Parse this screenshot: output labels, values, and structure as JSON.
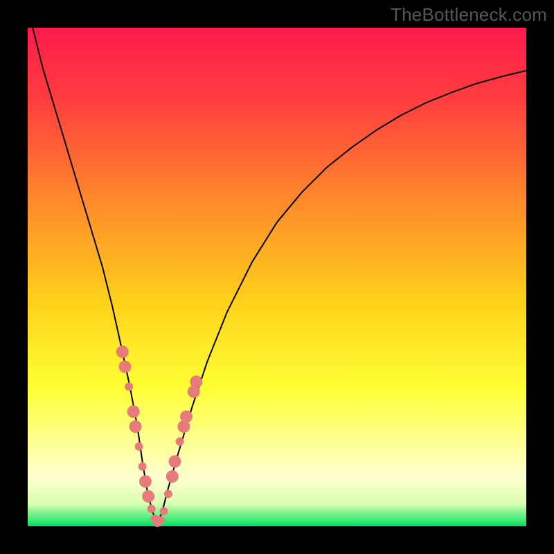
{
  "watermark": "TheBottleneck.com",
  "chart_data": {
    "type": "line",
    "title": "",
    "xlabel": "",
    "ylabel": "",
    "xlim": [
      0,
      100
    ],
    "ylim": [
      0,
      100
    ],
    "grid": false,
    "legend": false,
    "gradient_stops": [
      {
        "offset": 0.0,
        "color": "#ff1a4b"
      },
      {
        "offset": 0.15,
        "color": "#ff3f3f"
      },
      {
        "offset": 0.35,
        "color": "#ff8a2a"
      },
      {
        "offset": 0.55,
        "color": "#ffd11a"
      },
      {
        "offset": 0.72,
        "color": "#ffff33"
      },
      {
        "offset": 0.82,
        "color": "#ffff88"
      },
      {
        "offset": 0.9,
        "color": "#ffffd0"
      },
      {
        "offset": 0.955,
        "color": "#d9ffb0"
      },
      {
        "offset": 1.0,
        "color": "#00e060"
      }
    ],
    "series": [
      {
        "name": "bottleneck-curve",
        "x": [
          1,
          3,
          6,
          9,
          12,
          15,
          17,
          19,
          20.5,
          22,
          23,
          24,
          25,
          26,
          27,
          28,
          30,
          33,
          36,
          40,
          45,
          50,
          55,
          60,
          65,
          70,
          75,
          80,
          85,
          90,
          95,
          100
        ],
        "y": [
          100,
          92,
          82,
          72,
          62,
          52,
          44,
          35,
          28,
          20,
          13,
          7,
          3,
          0.5,
          3,
          7,
          14,
          24,
          33,
          43,
          53,
          61,
          67,
          72,
          76,
          79.5,
          82.5,
          85,
          87,
          88.8,
          90.2,
          91.4
        ]
      }
    ],
    "markers": {
      "name": "highlight-dots",
      "color": "#e77b7b",
      "radius_small": 6,
      "radius_large": 9,
      "points": [
        {
          "x": 19.0,
          "y": 35,
          "r": "large"
        },
        {
          "x": 19.5,
          "y": 32,
          "r": "large"
        },
        {
          "x": 20.3,
          "y": 28,
          "r": "small"
        },
        {
          "x": 21.2,
          "y": 23,
          "r": "large"
        },
        {
          "x": 21.6,
          "y": 20,
          "r": "large"
        },
        {
          "x": 22.3,
          "y": 16,
          "r": "small"
        },
        {
          "x": 23.0,
          "y": 12,
          "r": "small"
        },
        {
          "x": 23.6,
          "y": 9,
          "r": "large"
        },
        {
          "x": 24.2,
          "y": 6,
          "r": "large"
        },
        {
          "x": 24.8,
          "y": 3.5,
          "r": "small"
        },
        {
          "x": 25.5,
          "y": 1.5,
          "r": "small"
        },
        {
          "x": 26.0,
          "y": 0.7,
          "r": "small"
        },
        {
          "x": 26.6,
          "y": 1.2,
          "r": "small"
        },
        {
          "x": 27.3,
          "y": 3.0,
          "r": "small"
        },
        {
          "x": 28.2,
          "y": 6.5,
          "r": "small"
        },
        {
          "x": 29.0,
          "y": 10,
          "r": "large"
        },
        {
          "x": 29.5,
          "y": 13,
          "r": "large"
        },
        {
          "x": 30.5,
          "y": 17,
          "r": "small"
        },
        {
          "x": 31.3,
          "y": 20,
          "r": "large"
        },
        {
          "x": 31.8,
          "y": 22,
          "r": "large"
        },
        {
          "x": 33.3,
          "y": 27,
          "r": "large"
        },
        {
          "x": 33.8,
          "y": 29,
          "r": "large"
        }
      ]
    }
  }
}
